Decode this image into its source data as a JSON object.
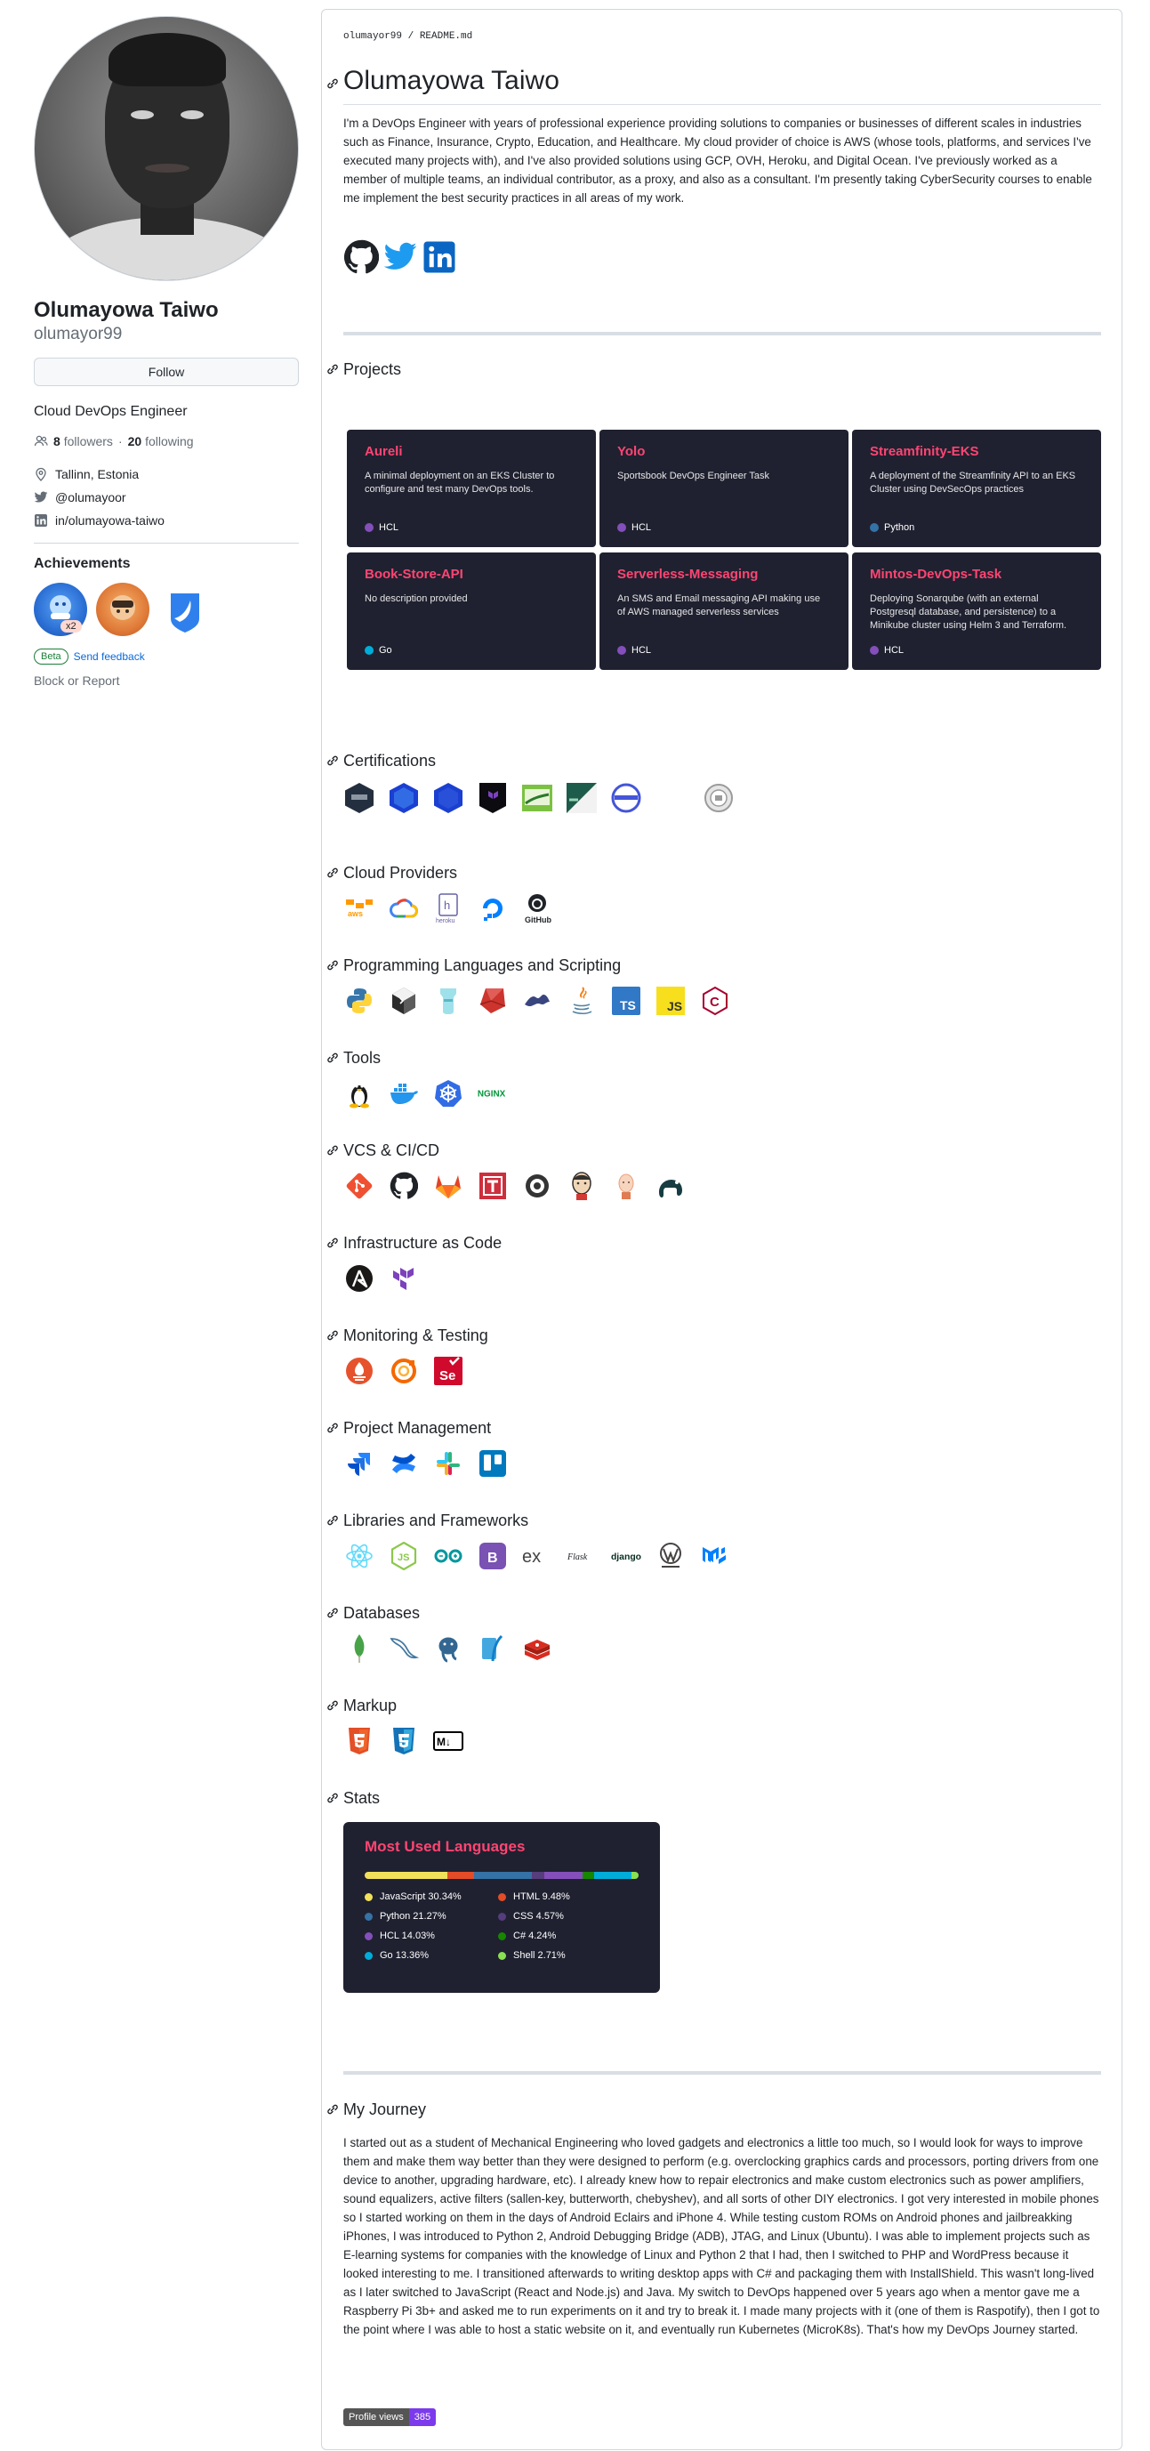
{
  "profile": {
    "fullname": "Olumayowa Taiwo",
    "username": "olumayor99",
    "follow_label": "Follow",
    "bio": "Cloud DevOps Engineer",
    "followers_count": "8",
    "followers_label": "followers",
    "separator": "·",
    "following_count": "20",
    "following_label": "following",
    "location": "Tallinn, Estonia",
    "twitter": "@olumayoor",
    "linkedin": "in/olumayowa-taiwo",
    "achievements_title": "Achievements",
    "achievement_multiplier": "x2",
    "beta_label": "Beta",
    "feedback_label": "Send feedback",
    "block_label": "Block or Report"
  },
  "readme": {
    "path_user": "olumayor99",
    "path_sep": " / ",
    "path_file": "README.md",
    "title": "Olumayowa Taiwo",
    "intro": "I'm a DevOps Engineer with years of professional experience providing solutions to companies or businesses of different scales in industries such as Finance, Insurance, Crypto, Education, and Healthcare. My cloud provider of choice is AWS (whose tools, platforms, and services I've executed many projects with), and I've also provided solutions using GCP, OVH, Heroku, and Digital Ocean. I've previously worked as a member of multiple teams, an individual contributor, as a proxy, and also as a consultant. I'm presently taking CyberSecurity courses to enable me implement the best security practices in all areas of my work.",
    "sections": {
      "projects": "Projects",
      "certifications": "Certifications",
      "cloud": "Cloud Providers",
      "languages": "Programming Languages and Scripting",
      "tools": "Tools",
      "vcs": "VCS & CI/CD",
      "iac": "Infrastructure as Code",
      "monitoring": "Monitoring & Testing",
      "pm": "Project Management",
      "libs": "Libraries and Frameworks",
      "databases": "Databases",
      "markup": "Markup",
      "stats": "Stats",
      "journey": "My Journey"
    },
    "projects": [
      {
        "name": "Aureli",
        "desc": "A minimal deployment on an EKS Cluster to configure and test many DevOps tools.",
        "lang": "HCL",
        "color": "#844fba"
      },
      {
        "name": "Yolo",
        "desc": "Sportsbook DevOps Engineer Task",
        "lang": "HCL",
        "color": "#844fba"
      },
      {
        "name": "Streamfinity-EKS",
        "desc": "A deployment of the Streamfinity API to an EKS Cluster using DevSecOps practices",
        "lang": "Python",
        "color": "#3572a5"
      },
      {
        "name": "Book-Store-API",
        "desc": "No description provided",
        "lang": "Go",
        "color": "#00add8"
      },
      {
        "name": "Serverless-Messaging",
        "desc": "An SMS and Email messaging API making use of AWS managed serverless services",
        "lang": "HCL",
        "color": "#844fba"
      },
      {
        "name": "Mintos-DevOps-Task",
        "desc": "Deploying Sonarqube (with an external Postgresql database, and persistence) to a Minikube cluster using Helm 3 and Terraform.",
        "lang": "HCL",
        "color": "#844fba"
      }
    ],
    "cloud_labels": {
      "aws": "aws",
      "heroku": "heroku",
      "github": "GitHub"
    },
    "tool_labels": {
      "nginx": "NGINX"
    },
    "lang_labels": {
      "ts": "TS",
      "js": "JS",
      "c": "C"
    },
    "lib_labels": {
      "ex": "ex",
      "flask": "Flask",
      "django": "django"
    },
    "markup_labels": {
      "md": "M↓"
    },
    "stats": {
      "title": "Most Used Languages",
      "langs": [
        {
          "name": "JavaScript",
          "pct": "30.34%",
          "value": 30.34,
          "color": "#f1e05a"
        },
        {
          "name": "HTML",
          "pct": "9.48%",
          "value": 9.48,
          "color": "#e34c26"
        },
        {
          "name": "Python",
          "pct": "21.27%",
          "value": 21.27,
          "color": "#3572a5"
        },
        {
          "name": "CSS",
          "pct": "4.57%",
          "value": 4.57,
          "color": "#563d7c"
        },
        {
          "name": "HCL",
          "pct": "14.03%",
          "value": 14.03,
          "color": "#844fba"
        },
        {
          "name": "C#",
          "pct": "4.24%",
          "value": 4.24,
          "color": "#178600"
        },
        {
          "name": "Go",
          "pct": "13.36%",
          "value": 13.36,
          "color": "#00add8"
        },
        {
          "name": "Shell",
          "pct": "2.71%",
          "value": 2.71,
          "color": "#89e051"
        }
      ]
    },
    "journey": "I started out as a student of Mechanical Engineering who loved gadgets and electronics a little too much, so I would look for ways to improve them and make them way better than they were designed to perform (e.g. overclocking graphics cards and processors, porting drivers from one device to another, upgrading hardware, etc). I already knew how to repair electronics and make custom electronics such as power amplifiers, sound equalizers, active filters (sallen-key, butterworth, chebyshev), and all sorts of other DIY electronics. I got very interested in mobile phones so I started working on them in the days of Android Eclairs and iPhone 4. While testing custom ROMs on Android phones and jailbreakking iPhones, I was introduced to Python 2, Android Debugging Bridge (ADB), JTAG, and Linux (Ubuntu). I was able to implement projects such as E-learning systems for companies with the knowledge of Linux and Python 2 that I had, then I switched to PHP and WordPress because it looked interesting to me. I transitioned afterwards to writing desktop apps with C# and packaging them with InstallShield. This wasn't long-lived as I later switched to JavaScript (React and Node.js) and Java. My switch to DevOps happened over 5 years ago when a mentor gave me a Raspberry Pi 3b+ and asked me to run experiments on it and try to break it. I made many projects with it (one of them is Raspotify), then I got to the point where I was able to host a static website on it, and eventually run Kubernetes (MicroK8s). That's how my DevOps Journey started.",
    "views_label": "Profile views",
    "views_count": "385"
  }
}
